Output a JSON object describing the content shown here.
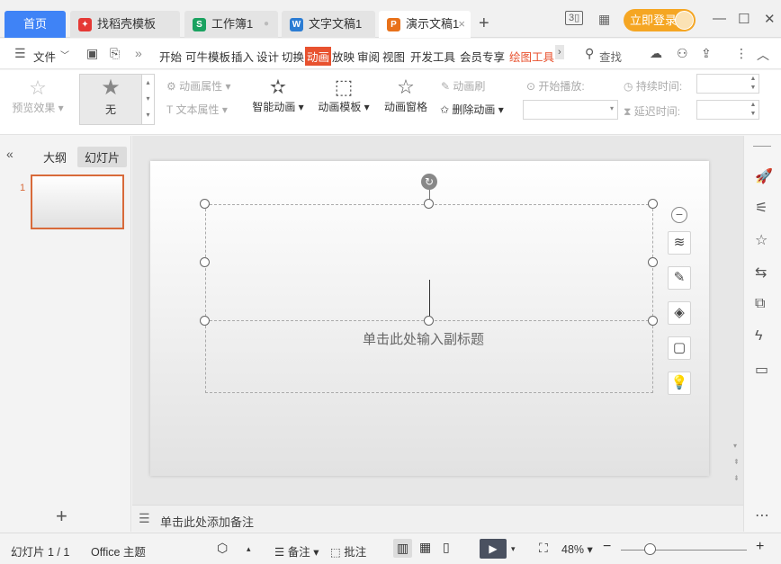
{
  "tabs": {
    "home": "首页",
    "items": [
      {
        "label": "找稻壳模板",
        "icon": "docer-icon",
        "color": "#e53935",
        "glyph": "✦"
      },
      {
        "label": "工作簿1",
        "icon": "spreadsheet-icon",
        "color": "#1aa260",
        "glyph": "S"
      },
      {
        "label": "文字文稿1",
        "icon": "writer-icon",
        "color": "#2b7cd3",
        "glyph": "W"
      },
      {
        "label": "演示文稿1",
        "icon": "presentation-icon",
        "color": "#e8711a",
        "glyph": "P"
      }
    ],
    "add": "+",
    "page_badge": "3",
    "login": "立即登录"
  },
  "menu": {
    "file": "文件",
    "items": [
      "开始",
      "可牛模板",
      "插入",
      "设计",
      "切换",
      "动画",
      "放映",
      "审阅",
      "视图",
      "开发工具",
      "会员专享",
      "绘图工具"
    ],
    "active": "动画",
    "search": "查找"
  },
  "ribbon": {
    "preview": "预览效果",
    "none": "无",
    "anim_props": "动画属性",
    "text_props": "文本属性",
    "smart_anim": "智能动画",
    "anim_template": "动画模板",
    "anim_pane": "动画窗格",
    "anim_brush": "动画刷",
    "delete_anim": "删除动画",
    "start_play": "开始播放:",
    "duration": "持续时间:",
    "delay": "延迟时间:"
  },
  "left": {
    "outline": "大纲",
    "slides": "幻灯片",
    "slide_number": "1",
    "add": "+"
  },
  "slide": {
    "subtitle_placeholder": "单击此处输入副标题"
  },
  "notes": {
    "placeholder": "单击此处添加备注"
  },
  "status": {
    "slide_counter": "幻灯片 1 / 1",
    "theme": "Office 主题",
    "notes": "备注",
    "comments": "批注",
    "zoom": "48%",
    "zoom_level": 0.48
  }
}
